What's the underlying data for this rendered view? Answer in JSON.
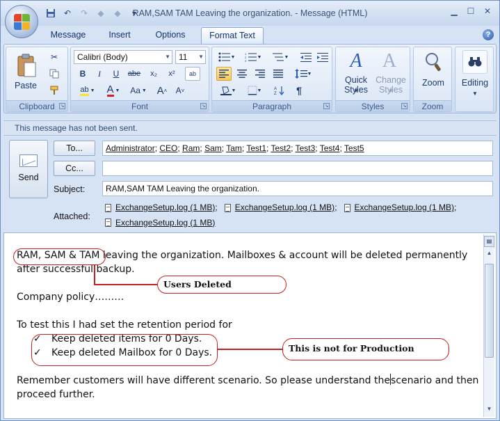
{
  "window": {
    "title": "RAM,SAM TAM Leaving the organization. - Message (HTML)"
  },
  "quick_access": {
    "icons": [
      "save-icon",
      "undo-icon",
      "redo-icon",
      "up-arrow-icon",
      "down-arrow-icon",
      "customize-icon"
    ]
  },
  "tabs": [
    {
      "label": "Message"
    },
    {
      "label": "Insert"
    },
    {
      "label": "Options"
    },
    {
      "label": "Format Text",
      "active": true
    }
  ],
  "ribbon": {
    "clipboard": {
      "label": "Clipboard",
      "paste": "Paste"
    },
    "font": {
      "label": "Font",
      "name": "Calibri (Body)",
      "size": "11",
      "buttons": [
        "B",
        "I",
        "U",
        "abe",
        "x₂",
        "x²",
        "ab",
        "A",
        "Aa",
        "A",
        "A"
      ]
    },
    "paragraph": {
      "label": "Paragraph"
    },
    "styles": {
      "label": "Styles",
      "quick": "Quick Styles",
      "change": "Change Styles"
    },
    "zoom": {
      "label": "Zoom",
      "button": "Zoom"
    },
    "editing": {
      "button": "Editing"
    }
  },
  "info_bar": "This message has not been sent.",
  "compose": {
    "send_label": "Send",
    "to_button": "To...",
    "cc_button": "Cc...",
    "to_recipients": [
      "Administrator",
      "CEO",
      "Ram",
      "Sam",
      "Tam",
      "Test1",
      "Test2",
      "Test3",
      "Test4",
      "Test5"
    ],
    "cc_value": "",
    "subject_label": "Subject:",
    "subject": "RAM,SAM TAM Leaving the organization.",
    "attached_label": "Attached:",
    "attachments": [
      "ExchangeSetup.log (1 MB)",
      "ExchangeSetup.log (1 MB)",
      "ExchangeSetup.log (1 MB)",
      "ExchangeSetup.log (1 MB)"
    ]
  },
  "body": {
    "p1_highlight": "RAM, SAM & TAM",
    "p1_rest": " leaving the organization. Mailboxes & account will be deleted permanently after successful backup.",
    "p2": "Company policy………",
    "p3": "To test this I had set the retention period for",
    "bullets": [
      "Keep deleted items for 0 Days.",
      "Keep deleted Mailbox for 0 Days."
    ],
    "p4_before_cursor": "Remember customers will have different scenario. So please understand the",
    "p4_after_cursor": "scenario and then proceed further."
  },
  "annotations": {
    "users_deleted": "Users Deleted",
    "not_for_production": "This is not for Production"
  },
  "colors": {
    "annotation": "#c02020",
    "ribbon": "#d6e3f4"
  }
}
